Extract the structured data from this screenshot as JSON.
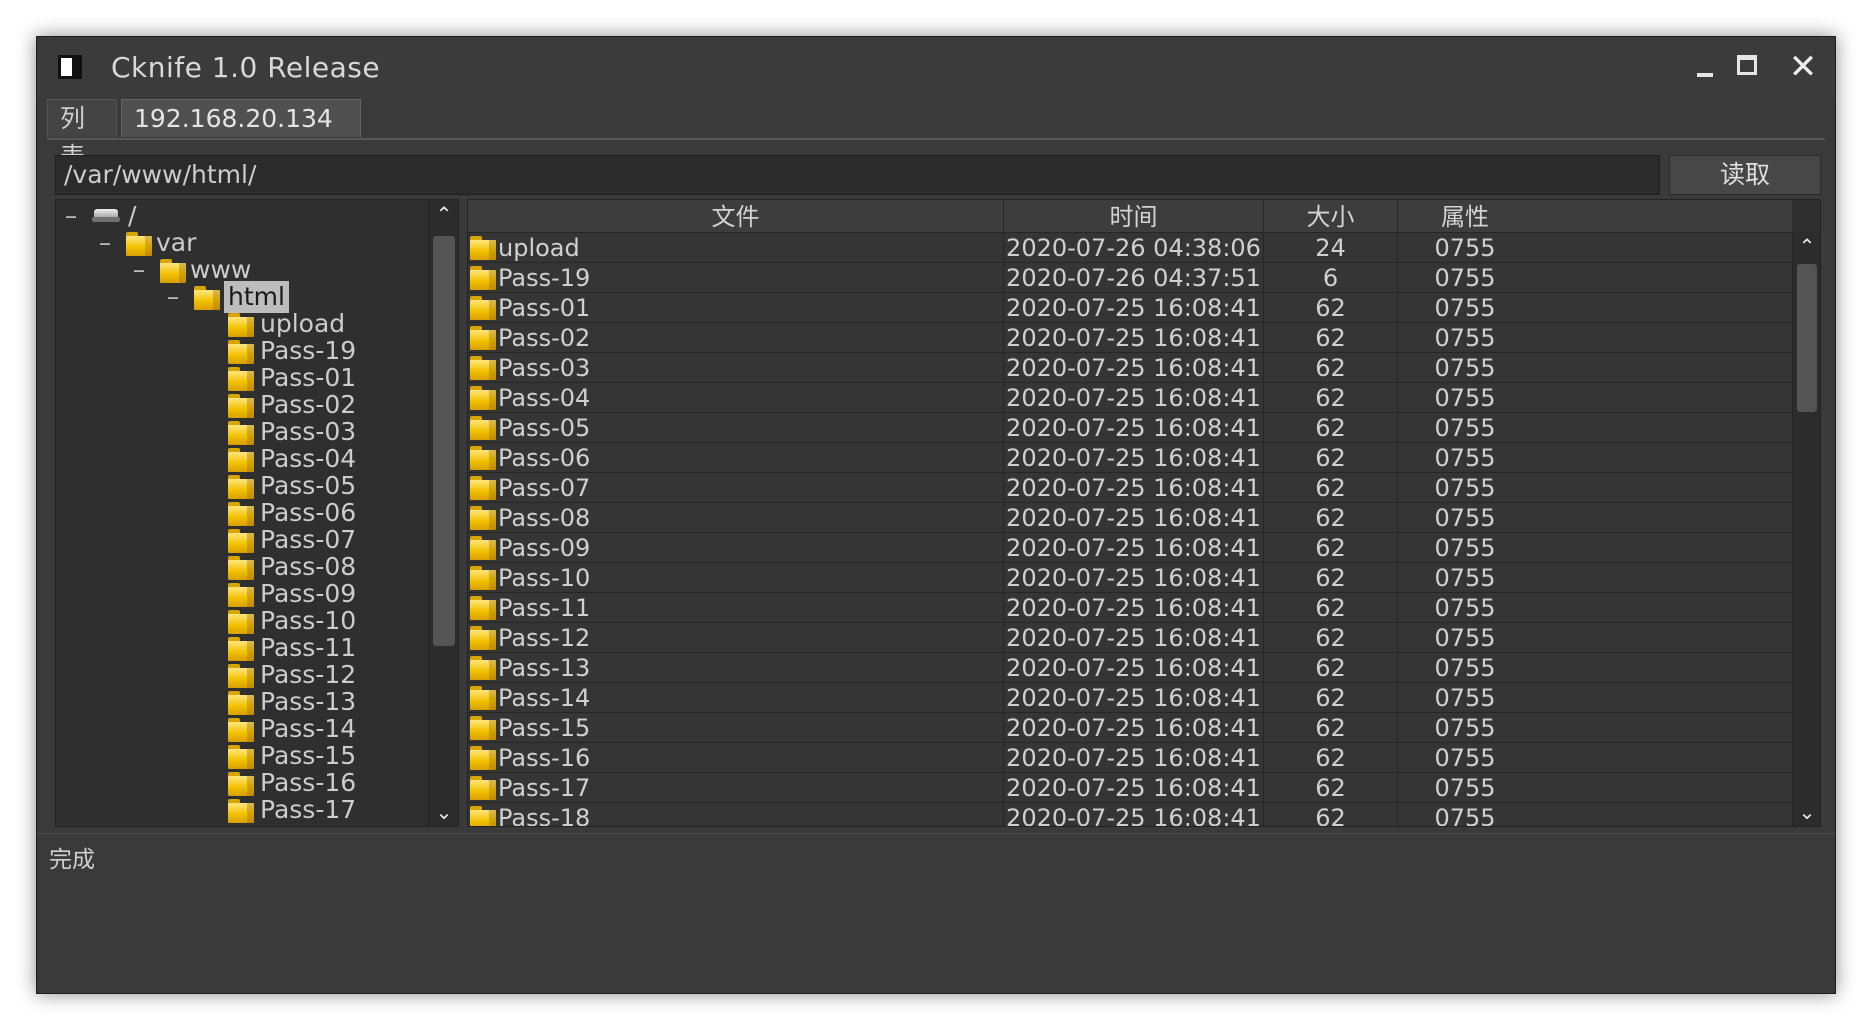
{
  "window": {
    "title": "Cknife 1.0 Release"
  },
  "tabs": [
    {
      "label": "列表"
    },
    {
      "label": "192.168.20.134"
    }
  ],
  "toolbar": {
    "path": "/var/www/html/",
    "read_label": "读取"
  },
  "tree": {
    "root": "/",
    "var": "var",
    "www": "www",
    "html": "html",
    "children": [
      "upload",
      "Pass-19",
      "Pass-01",
      "Pass-02",
      "Pass-03",
      "Pass-04",
      "Pass-05",
      "Pass-06",
      "Pass-07",
      "Pass-08",
      "Pass-09",
      "Pass-10",
      "Pass-11",
      "Pass-12",
      "Pass-13",
      "Pass-14",
      "Pass-15",
      "Pass-16",
      "Pass-17"
    ]
  },
  "table": {
    "columns": {
      "name": "文件",
      "time": "时间",
      "size": "大小",
      "attr": "属性"
    },
    "rows": [
      {
        "name": "upload",
        "time": "2020-07-26 04:38:06",
        "size": "24",
        "attr": "0755"
      },
      {
        "name": "Pass-19",
        "time": "2020-07-26 04:37:51",
        "size": "6",
        "attr": "0755"
      },
      {
        "name": "Pass-01",
        "time": "2020-07-25 16:08:41",
        "size": "62",
        "attr": "0755"
      },
      {
        "name": "Pass-02",
        "time": "2020-07-25 16:08:41",
        "size": "62",
        "attr": "0755"
      },
      {
        "name": "Pass-03",
        "time": "2020-07-25 16:08:41",
        "size": "62",
        "attr": "0755"
      },
      {
        "name": "Pass-04",
        "time": "2020-07-25 16:08:41",
        "size": "62",
        "attr": "0755"
      },
      {
        "name": "Pass-05",
        "time": "2020-07-25 16:08:41",
        "size": "62",
        "attr": "0755"
      },
      {
        "name": "Pass-06",
        "time": "2020-07-25 16:08:41",
        "size": "62",
        "attr": "0755"
      },
      {
        "name": "Pass-07",
        "time": "2020-07-25 16:08:41",
        "size": "62",
        "attr": "0755"
      },
      {
        "name": "Pass-08",
        "time": "2020-07-25 16:08:41",
        "size": "62",
        "attr": "0755"
      },
      {
        "name": "Pass-09",
        "time": "2020-07-25 16:08:41",
        "size": "62",
        "attr": "0755"
      },
      {
        "name": "Pass-10",
        "time": "2020-07-25 16:08:41",
        "size": "62",
        "attr": "0755"
      },
      {
        "name": "Pass-11",
        "time": "2020-07-25 16:08:41",
        "size": "62",
        "attr": "0755"
      },
      {
        "name": "Pass-12",
        "time": "2020-07-25 16:08:41",
        "size": "62",
        "attr": "0755"
      },
      {
        "name": "Pass-13",
        "time": "2020-07-25 16:08:41",
        "size": "62",
        "attr": "0755"
      },
      {
        "name": "Pass-14",
        "time": "2020-07-25 16:08:41",
        "size": "62",
        "attr": "0755"
      },
      {
        "name": "Pass-15",
        "time": "2020-07-25 16:08:41",
        "size": "62",
        "attr": "0755"
      },
      {
        "name": "Pass-16",
        "time": "2020-07-25 16:08:41",
        "size": "62",
        "attr": "0755"
      },
      {
        "name": "Pass-17",
        "time": "2020-07-25 16:08:41",
        "size": "62",
        "attr": "0755"
      },
      {
        "name": "Pass-18",
        "time": "2020-07-25 16:08:41",
        "size": "62",
        "attr": "0755"
      }
    ]
  },
  "status": {
    "text": "完成"
  },
  "colors": {
    "window_bg": "#3a3a3a",
    "panel_bg": "#2f2f2f",
    "folder": "#f2c200",
    "selection": "#bdbdbd"
  }
}
